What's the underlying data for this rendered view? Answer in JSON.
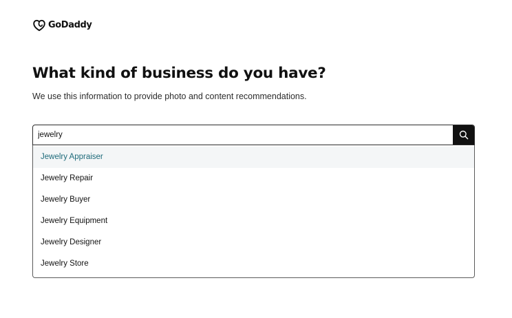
{
  "brand": {
    "name": "GoDaddy",
    "logo_icon": "godaddy-heart-icon"
  },
  "page": {
    "title": "What kind of business do you have?",
    "subtitle": "We use this information to provide photo and content recommendations."
  },
  "search": {
    "value": "jewelry",
    "button_icon": "search-icon"
  },
  "suggestions": [
    {
      "label": "Jewelry Appraiser",
      "active": true
    },
    {
      "label": "Jewelry Repair",
      "active": false
    },
    {
      "label": "Jewelry Buyer",
      "active": false
    },
    {
      "label": "Jewelry Equipment",
      "active": false
    },
    {
      "label": "Jewelry Designer",
      "active": false
    },
    {
      "label": "Jewelry Store",
      "active": false
    }
  ],
  "colors": {
    "text": "#111111",
    "active_suggestion_text": "#1d6a7a",
    "active_suggestion_bg": "#f4f6f7",
    "search_button_bg": "#111111"
  }
}
